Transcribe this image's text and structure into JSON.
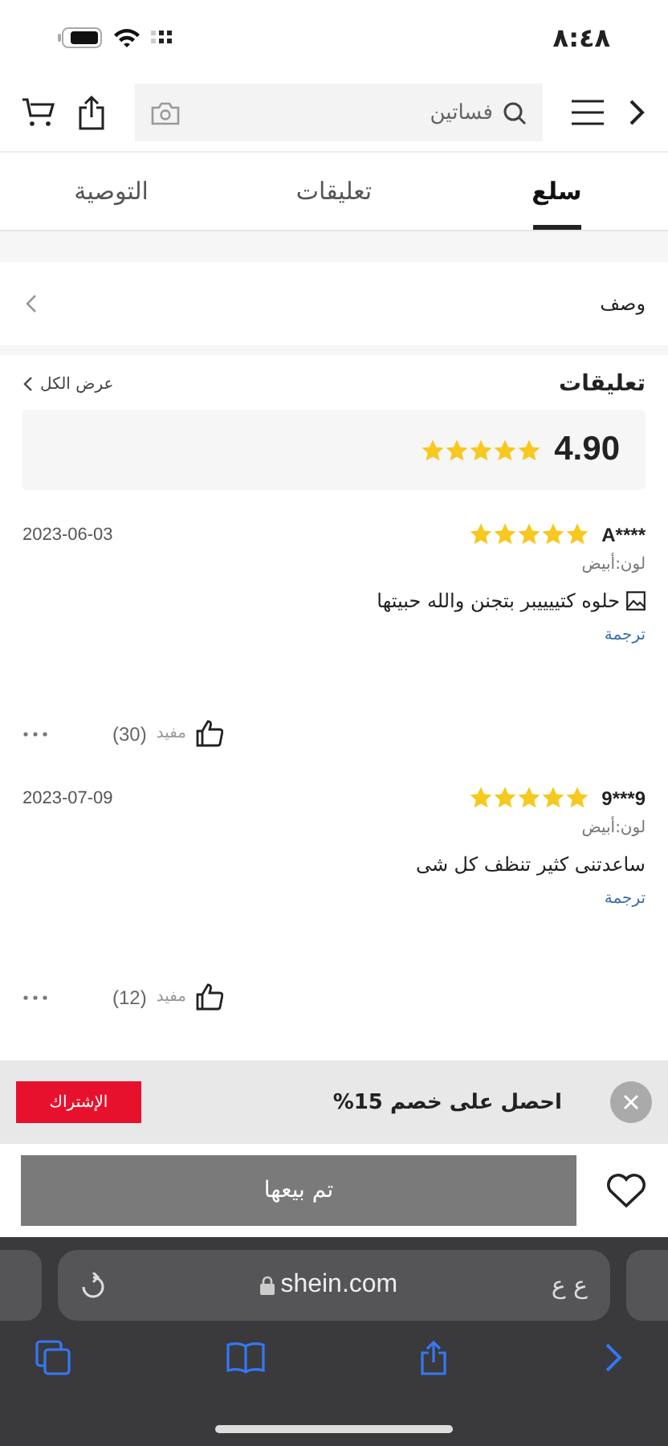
{
  "status_bar": {
    "time": "٨:٤٨"
  },
  "search": {
    "placeholder": "فساتين"
  },
  "tabs": [
    {
      "label": "سلع",
      "selected": true
    },
    {
      "label": "تعليقات",
      "selected": false
    },
    {
      "label": "التوصية",
      "selected": false
    }
  ],
  "description_row": {
    "label": "وصف"
  },
  "reviews": {
    "title": "تعليقات",
    "view_all": "عرض الكل",
    "score": "4.90",
    "stars": 5,
    "items": [
      {
        "user": "A****",
        "stars": 5,
        "date": "2023-06-03",
        "variant": "لون:أبيض",
        "has_image": true,
        "text": "حلوه كتييييبر بتجنن والله حبيتها",
        "translate": "ترجمة",
        "helpful": "مفيد",
        "helpful_count": "(30)"
      },
      {
        "user": "9***9",
        "stars": 5,
        "date": "2023-07-09",
        "variant": "لون:أبيض",
        "has_image": false,
        "text": "ساعدتنى كثير تنظف كل شى",
        "translate": "ترجمة",
        "helpful": "مفيد",
        "helpful_count": "(12)"
      }
    ]
  },
  "promo": {
    "text": "احصل على خصم 15%",
    "button": "الإشتراك"
  },
  "bottom_bar": {
    "button": "تم بيعها"
  },
  "browser": {
    "url": "shein.com",
    "text_size": "ع ع"
  }
}
